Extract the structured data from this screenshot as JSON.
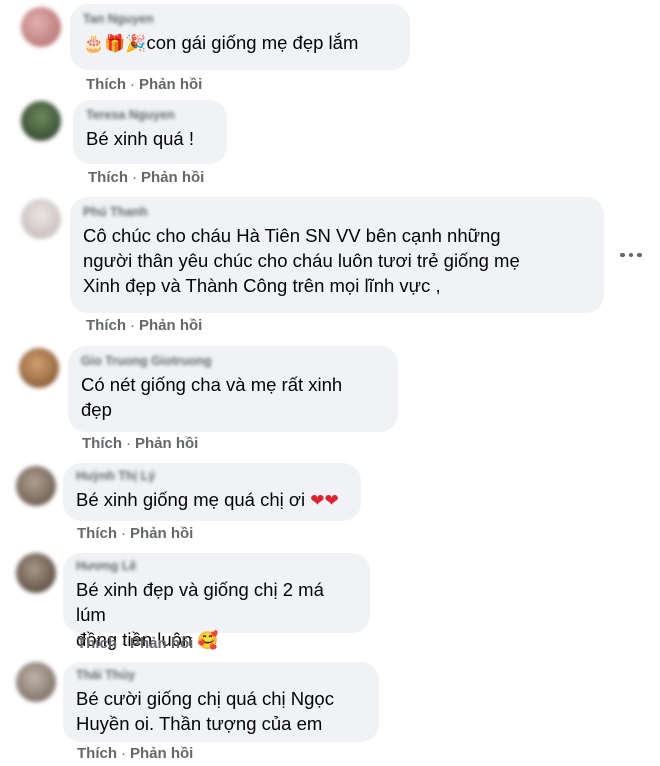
{
  "comments": [
    {
      "author": "Tan Nguyen",
      "text": "con gái giống mẹ đẹp lắm",
      "prefix_emoji": "🎂🎁🎉",
      "like_label": "Thích",
      "reply_label": "Phản hồi",
      "avatar_color": "#c98a8a"
    },
    {
      "author": "Teresa Nguyen",
      "text": "Bé xinh quá !",
      "like_label": "Thích",
      "reply_label": "Phản hồi",
      "avatar_color": "#3a5a3a"
    },
    {
      "author": "Phú Thanh",
      "text": "Cô chúc cho cháu Hà Tiên SN VV bên cạnh những\nngười thân yêu chúc cho cháu luôn tươi trẻ giống mẹ\nXinh đẹp và Thành Công trên mọi lĩnh vực ,",
      "like_label": "Thích",
      "reply_label": "Phản hồi",
      "avatar_color": "#d8d0d0"
    },
    {
      "author": "Gio Truong Giotruong",
      "text": "Có nét giống cha và mẹ rất xinh\nđẹp",
      "like_label": "Thích",
      "reply_label": "Phản hồi",
      "avatar_color": "#a0704a"
    },
    {
      "author": "Huỳnh Thị Lý",
      "text": "Bé xinh giống mẹ quá chị ơi",
      "suffix_emoji": "❤❤",
      "like_label": "Thích",
      "reply_label": "Phản hồi",
      "avatar_color": "#8a7b70"
    },
    {
      "author": "Hương Lê",
      "text": "Bé xinh đẹp và giống chị 2 má lúm\nđồng tiền luôn",
      "suffix_emoji": "🥰",
      "like_label": "Thích",
      "reply_label": "Phản hồi",
      "avatar_color": "#7a6a62"
    },
    {
      "author": "Thái Thủy",
      "text": "Bé cười giống chị quá chị Ngọc\nHuyền oi. Thần tượng của em",
      "like_label": "Thích",
      "reply_label": "Phản hồi",
      "avatar_color": "#9a8f88"
    }
  ],
  "more_options_label": "…"
}
